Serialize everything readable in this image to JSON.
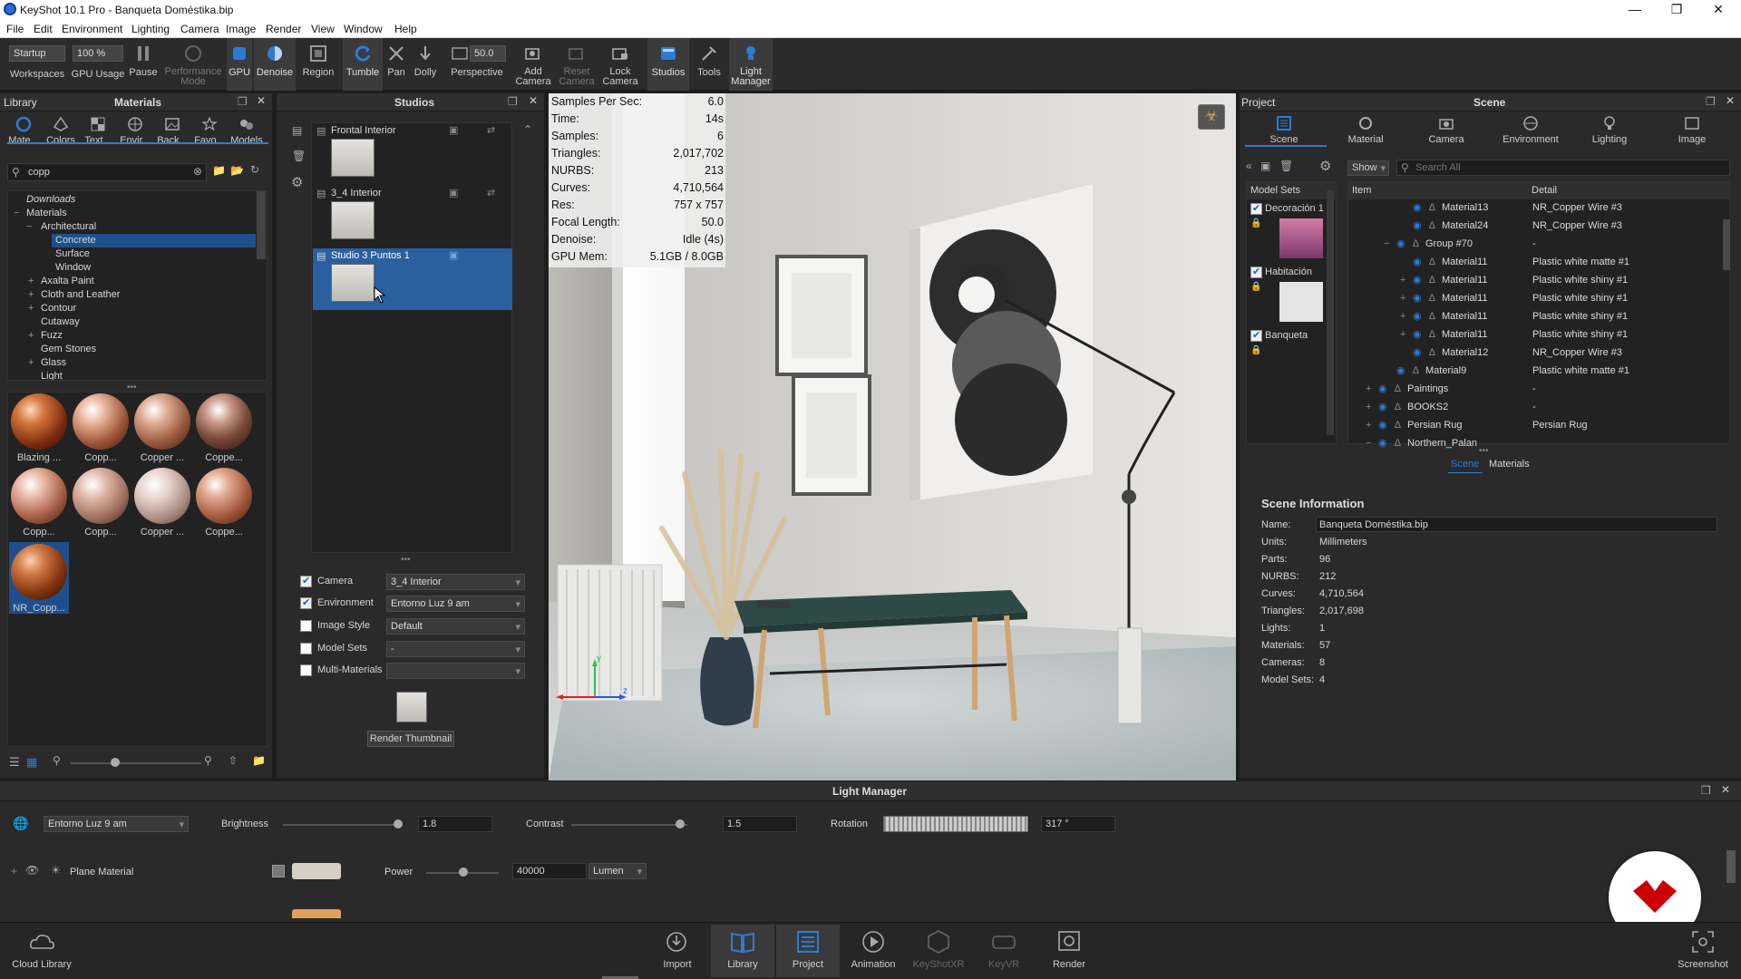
{
  "window": {
    "title": "KeyShot 10.1 Pro - Banqueta Doméstika.bip"
  },
  "menu": [
    "File",
    "Edit",
    "Environment",
    "Lighting",
    "Camera",
    "Image",
    "Render",
    "View",
    "Window",
    "Help"
  ],
  "toolbar": {
    "workspace_value": "Startup",
    "workspaces_label": "Workspaces",
    "gpu_usage_value": "100 %",
    "gpu_usage_label": "GPU Usage",
    "pause_label": "Pause",
    "performance_label": "Performance\nMode",
    "gpu_label": "GPU",
    "denoise_label": "Denoise",
    "region_label": "Region",
    "tumble_label": "Tumble",
    "pan_label": "Pan",
    "dolly_label": "Dolly",
    "perspective_value": "50.0",
    "perspective_label": "Perspective",
    "add_camera_label": "Add\nCamera",
    "reset_camera_label": "Reset\nCamera",
    "lock_camera_label": "Lock\nCamera",
    "studios_label": "Studios",
    "tools_label": "Tools",
    "light_manager_label": "Light\nManager"
  },
  "library": {
    "title": "Library",
    "subtitle": "Materials",
    "tabs": [
      "Mate...",
      "Colors",
      "Text...",
      "Envir...",
      "Back...",
      "Favo...",
      "Models"
    ],
    "search_value": "copp",
    "tree": [
      {
        "label": "Downloads",
        "italic": true
      },
      {
        "label": "Materials"
      },
      {
        "label": "Architectural"
      },
      {
        "label": "Concrete",
        "selected": true
      },
      {
        "label": "Surface"
      },
      {
        "label": "Window"
      },
      {
        "label": "Axalta Paint"
      },
      {
        "label": "Cloth and Leather"
      },
      {
        "label": "Contour"
      },
      {
        "label": "Cutaway"
      },
      {
        "label": "Fuzz"
      },
      {
        "label": "Gem Stones"
      },
      {
        "label": "Glass"
      },
      {
        "label": "Light"
      }
    ],
    "thumbnails": [
      "Blazing ...",
      "Copp...",
      "Copper ...",
      "Coppe...",
      "Copp...",
      "Copp...",
      "Copper ...",
      "Coppe...",
      "NR_Copp..."
    ]
  },
  "studios": {
    "title": "Studios",
    "items": [
      {
        "label": "Frontal Interior",
        "selected": false
      },
      {
        "label": "3_4 Interior",
        "selected": false
      },
      {
        "label": "Studio 3 Puntos 1",
        "selected": true
      }
    ],
    "props": [
      {
        "label": "Camera",
        "checked": true,
        "value": "3_4 Interior"
      },
      {
        "label": "Environment",
        "checked": true,
        "value": "Entorno Luz 9 am"
      },
      {
        "label": "Image Style",
        "checked": false,
        "value": "Default"
      },
      {
        "label": "Model Sets",
        "checked": false,
        "value": "-"
      },
      {
        "label": "Multi-Materials",
        "checked": false,
        "value": ""
      }
    ],
    "render_thumbnail_label": "Render Thumbnail"
  },
  "viewport": {
    "stats": [
      {
        "k": "Samples Per Sec:",
        "v": "6.0"
      },
      {
        "k": "Time:",
        "v": "14s"
      },
      {
        "k": "Samples:",
        "v": "6"
      },
      {
        "k": "Triangles:",
        "v": "2,017,702"
      },
      {
        "k": "NURBS:",
        "v": "213"
      },
      {
        "k": "Curves:",
        "v": "4,710,564"
      },
      {
        "k": "Res:",
        "v": "757 x 757"
      },
      {
        "k": "Focal Length:",
        "v": "50.0"
      },
      {
        "k": "Denoise:",
        "v": "Idle (4s)"
      },
      {
        "k": "GPU Mem:",
        "v": "5.1GB / 8.0GB"
      }
    ],
    "axis_labels": {
      "y": "y",
      "z": "z"
    }
  },
  "project": {
    "title": "Project",
    "subtitle": "Scene",
    "tabs": [
      "Scene",
      "Material",
      "Camera",
      "Environment",
      "Lighting",
      "Image"
    ],
    "show_label": "Show",
    "search_placeholder": "Search All",
    "model_sets_header": "Model Sets",
    "model_sets": [
      "Decoración 1",
      "Habitación",
      "Banqueta"
    ],
    "tree_headers": {
      "item": "Item",
      "detail": "Detail"
    },
    "tree": [
      {
        "item": "Material13",
        "detail": "NR_Copper Wire #3"
      },
      {
        "item": "Material24",
        "detail": "NR_Copper Wire #3"
      },
      {
        "item": "Group #70",
        "detail": "-"
      },
      {
        "item": "Material11",
        "detail": "Plastic white matte #1"
      },
      {
        "item": "Material11",
        "detail": "Plastic white shiny #1"
      },
      {
        "item": "Material11",
        "detail": "Plastic white shiny #1"
      },
      {
        "item": "Material11",
        "detail": "Plastic white shiny #1"
      },
      {
        "item": "Material11",
        "detail": "Plastic white shiny #1"
      },
      {
        "item": "Material12",
        "detail": "NR_Copper Wire #3"
      },
      {
        "item": "Material9",
        "detail": "Plastic white matte #1"
      },
      {
        "item": "Paintings",
        "detail": "-"
      },
      {
        "item": "BOOKS2",
        "detail": "-"
      },
      {
        "item": "Persian Rug",
        "detail": "Persian Rug"
      },
      {
        "item": "Northern_Palan",
        "detail": ""
      }
    ],
    "subtabs": [
      "Scene",
      "Materials"
    ],
    "info_title": "Scene Information",
    "info": [
      {
        "k": "Name:",
        "v": "Banqueta Doméstika.bip"
      },
      {
        "k": "Units:",
        "v": "Millimeters"
      },
      {
        "k": "Parts:",
        "v": "96"
      },
      {
        "k": "NURBS:",
        "v": "212"
      },
      {
        "k": "Curves:",
        "v": "4,710,564"
      },
      {
        "k": "Triangles:",
        "v": "2,017,698"
      },
      {
        "k": "Lights:",
        "v": "1"
      },
      {
        "k": "Materials:",
        "v": "57"
      },
      {
        "k": "Cameras:",
        "v": "8"
      },
      {
        "k": "Model Sets:",
        "v": "4"
      }
    ]
  },
  "light_manager": {
    "title": "Light Manager",
    "environment": "Entorno Luz 9 am",
    "brightness_label": "Brightness",
    "brightness_value": "1.8",
    "contrast_label": "Contrast",
    "contrast_value": "1.5",
    "rotation_label": "Rotation",
    "rotation_value": "317 °",
    "material_label": "Plane Material",
    "power_label": "Power",
    "power_value": "40000",
    "unit_value": "Lumen"
  },
  "bottom_bar": {
    "cloud_library": "Cloud Library",
    "items": [
      "Import",
      "Library",
      "Project",
      "Animation",
      "KeyShotXR",
      "KeyVR",
      "Render"
    ],
    "screenshot": "Screenshot"
  },
  "colors": {
    "accent": "#2d7bd6",
    "selection": "#2a5fa0",
    "brand_red": "#cc0000"
  }
}
